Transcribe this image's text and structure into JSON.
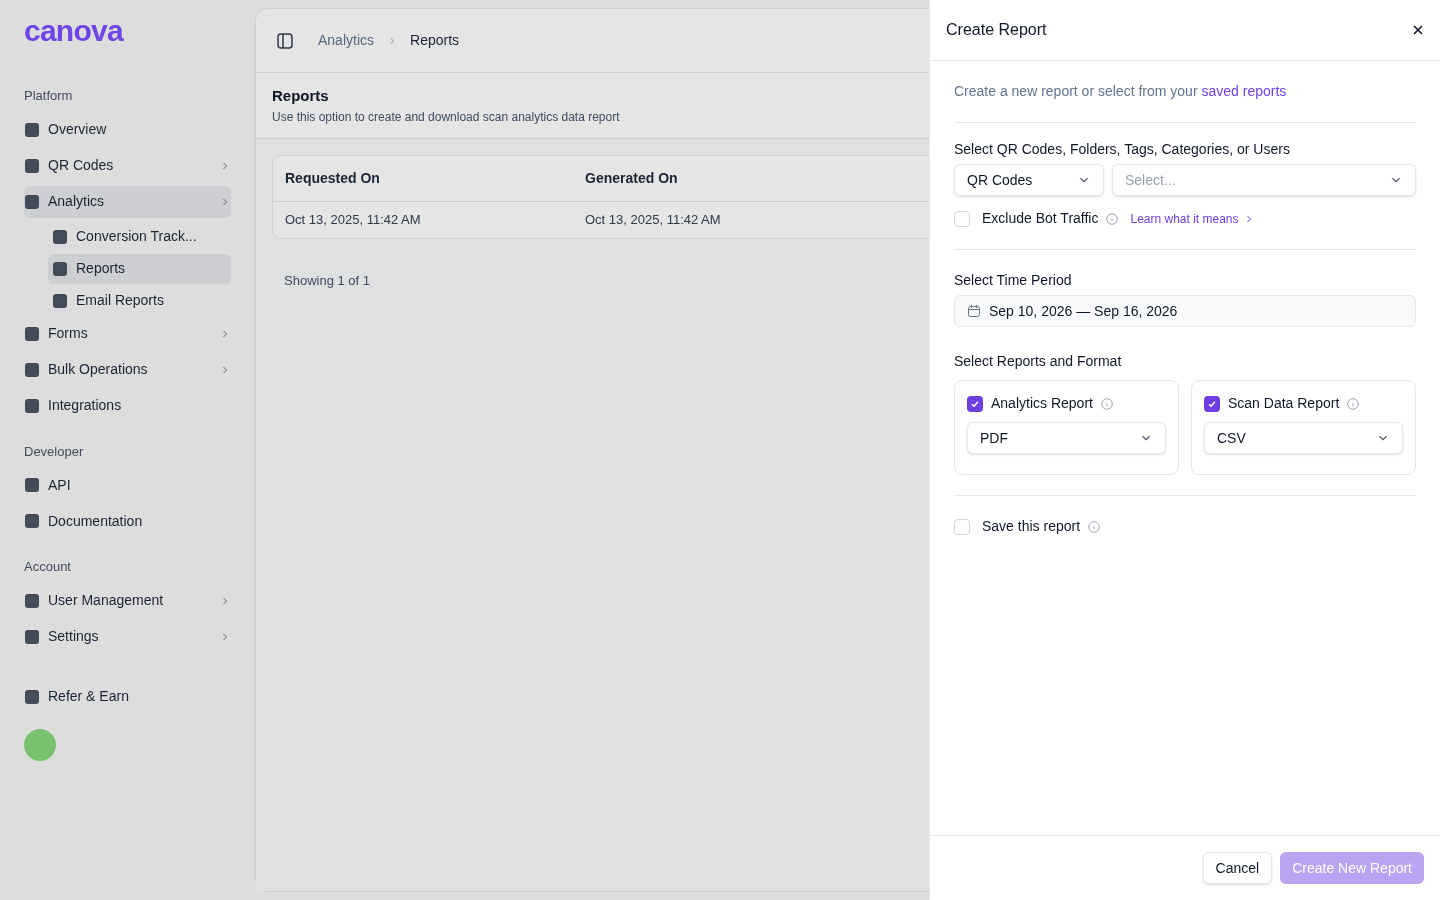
{
  "sidebar": {
    "logo": "canova",
    "sections": [
      {
        "title": "Platform",
        "items": [
          {
            "label": "Overview",
            "expandable": false,
            "selected": false
          },
          {
            "label": "QR Codes",
            "expandable": true,
            "selected": false
          },
          {
            "label": "Analytics",
            "expandable": true,
            "selected": true,
            "children": [
              {
                "label": "Conversion Track...",
                "selected": false
              },
              {
                "label": "Reports",
                "selected": true
              },
              {
                "label": "Email Reports",
                "selected": false
              }
            ]
          },
          {
            "label": "Forms",
            "expandable": true,
            "selected": false
          },
          {
            "label": "Bulk Operations",
            "expandable": true,
            "selected": false
          },
          {
            "label": "Integrations",
            "expandable": false,
            "selected": false
          }
        ]
      },
      {
        "title": "Developer",
        "items": [
          {
            "label": "API",
            "expandable": false,
            "selected": false
          },
          {
            "label": "Documentation",
            "expandable": false,
            "selected": false
          }
        ]
      },
      {
        "title": "Account",
        "items": [
          {
            "label": "User Management",
            "expandable": true,
            "selected": false
          },
          {
            "label": "Settings",
            "expandable": true,
            "selected": false
          }
        ]
      }
    ],
    "refer": "Refer & Earn"
  },
  "breadcrumb": [
    "Analytics",
    "Reports"
  ],
  "page": {
    "title": "Reports",
    "subtitle": "Use this option to create and download scan analytics data report",
    "table": {
      "columns": [
        "Requested On",
        "Generated On"
      ],
      "rows": [
        [
          "Oct 13, 2025, 11:42 AM",
          "Oct 13, 2025, 11:42 AM"
        ]
      ]
    },
    "footer": "Showing 1 of 1"
  },
  "panel": {
    "title": "Create Report",
    "intro": "Create a new report or select from your",
    "intro_link": "saved reports",
    "selection": {
      "label": "Select QR Codes, Folders, Tags, Categories, or Users",
      "type_value": "QR Codes",
      "placeholder": "Select..."
    },
    "exclude_bot": {
      "label": "Exclude Bot Traffic",
      "checked": false,
      "link": "Learn what it means"
    },
    "period": {
      "label": "Select Time Period",
      "value": "Sep 10, 2026 — Sep 16, 2026"
    },
    "reports_label": "Select Reports and Format",
    "reports": [
      {
        "label": "Analytics Report",
        "checked": true,
        "format": "PDF"
      },
      {
        "label": "Scan Data Report",
        "checked": true,
        "format": "CSV"
      }
    ],
    "save": {
      "label": "Save this report",
      "checked": false
    },
    "buttons": {
      "cancel": "Cancel",
      "create": "Create New Report",
      "create_disabled": true
    }
  }
}
